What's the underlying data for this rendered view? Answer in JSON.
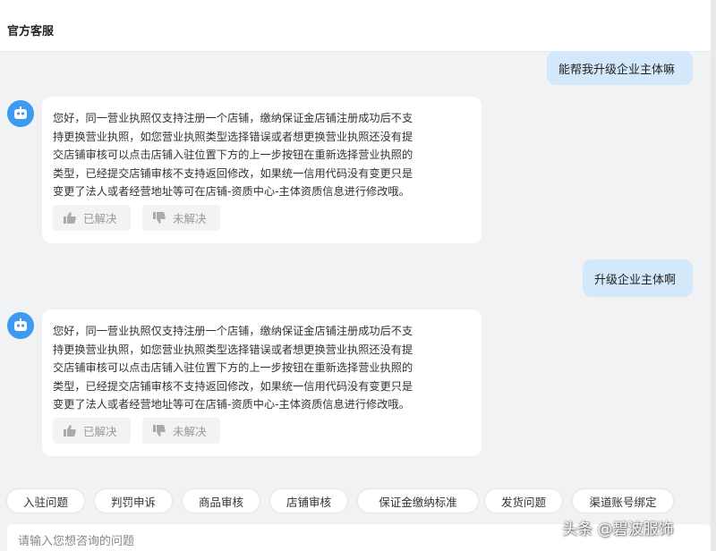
{
  "header": {
    "title": "官方客服"
  },
  "messages": [
    {
      "role": "user",
      "text": "能帮我升级企业主体嘛"
    },
    {
      "role": "bot",
      "lines": [
        "您好，同一营业执照仅支持注册一个店铺，缴纳保证金店铺注册成功后不支",
        "持更换营业执照，如您营业执照类型选择错误或者想更换营业执照还没有提",
        "交店铺审核可以点击店铺入驻位置下方的上一步按钮在重新选择营业执照的",
        "类型，已经提交店铺审核不支持返回修改，如果统一信用代码没有变更只是",
        "变更了法人或者经营地址等可在店铺-资质中心-主体资质信息进行修改哦。"
      ],
      "feedback": {
        "solved": "已解决",
        "unsolved": "未解决"
      }
    },
    {
      "role": "user",
      "text": "升级企业主体啊"
    },
    {
      "role": "bot",
      "lines": [
        "您好，同一营业执照仅支持注册一个店铺，缴纳保证金店铺注册成功后不支",
        "持更换营业执照，如您营业执照类型选择错误或者想更换营业执照还没有提",
        "交店铺审核可以点击店铺入驻位置下方的上一步按钮在重新选择营业执照的",
        "类型，已经提交店铺审核不支持返回修改，如果统一信用代码没有变更只是",
        "变更了法人或者经营地址等可在店铺-资质中心-主体资质信息进行修改哦。"
      ],
      "feedback": {
        "solved": "已解决",
        "unsolved": "未解决"
      }
    }
  ],
  "quick_questions": [
    "入驻问题",
    "判罚申诉",
    "商品审核",
    "店铺审核",
    "保证金缴纳标准",
    "发货问题",
    "渠道账号绑定"
  ],
  "input": {
    "placeholder": "请输入您想咨询的问题",
    "value": ""
  },
  "watermark": "头条 @碧波服饰",
  "colors": {
    "user_bubble": "#d3e8fb",
    "avatar": "#3d9af0",
    "background": "#f1f2f4"
  },
  "icons": {
    "avatar": "robot-icon",
    "solved": "thumbs-up-icon",
    "unsolved": "thumbs-down-icon"
  }
}
